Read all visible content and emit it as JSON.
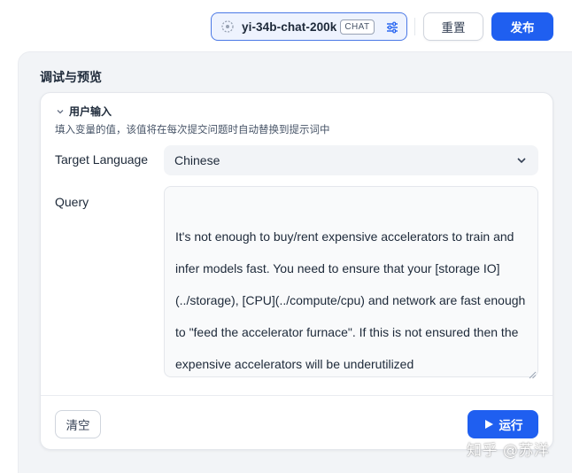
{
  "header": {
    "model_name": "yi-34b-chat-200k",
    "model_badge": "CHAT",
    "reset_label": "重置",
    "publish_label": "发布"
  },
  "panel": {
    "title": "调试与预览",
    "section_label": "用户输入",
    "hint": "填入变量的值，该值将在每次提交问题时自动替换到提示词中"
  },
  "fields": {
    "target_language_label": "Target Language",
    "target_language_value": "Chinese",
    "query_label": "Query",
    "query_value": "It's not enough to buy/rent expensive accelerators to train and infer models fast. You need to ensure that your [storage IO](../storage), [CPU](../compute/cpu) and network are fast enough to \"feed the accelerator furnace\". If this is not ensured then the expensive accelerators will be underutilized"
  },
  "actions": {
    "clear_label": "清空",
    "run_label": "运行"
  },
  "watermark": "知乎 @苏洋",
  "colors": {
    "primary": "#1f5ff0",
    "panel_bg": "#f2f4f7",
    "model_border": "#4b79e6"
  },
  "icons": [
    "model-icon",
    "settings-sliders-icon",
    "chevron-down-icon",
    "play-icon",
    "resize-grip-icon"
  ]
}
